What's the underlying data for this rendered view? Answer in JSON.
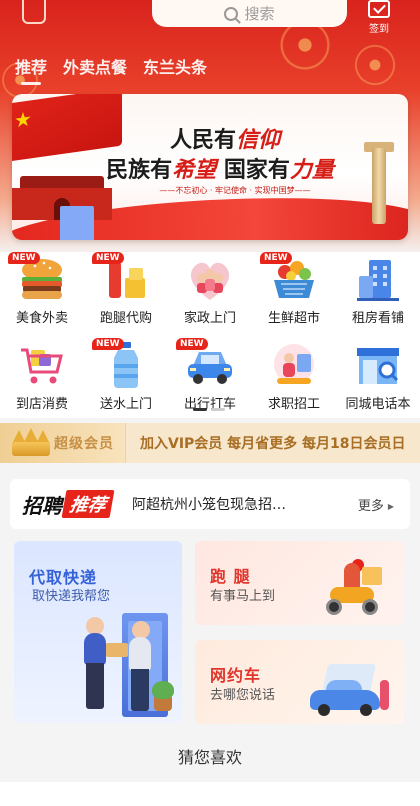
{
  "header": {
    "search_placeholder": "搜索",
    "signin_label": "签到",
    "tabs": [
      {
        "label": "推荐",
        "active": true
      },
      {
        "label": "外卖点餐",
        "active": false
      },
      {
        "label": "东兰头条",
        "active": false
      }
    ],
    "colors": {
      "primary": "#d9231d",
      "accent": "#e6241a"
    }
  },
  "banner": {
    "line1_a": "人民有",
    "line1_b": "信仰",
    "line2_a": "民族有",
    "line2_b": "希望",
    "line2_c": " 国家有",
    "line2_d": "力量",
    "line3": "——不忘初心 · 牢记使命 · 实现中国梦——"
  },
  "services": {
    "new_badge": "NEW",
    "items": [
      {
        "label": "美食外卖",
        "icon": "burger-icon",
        "new": true
      },
      {
        "label": "跑腿代购",
        "icon": "errand-icon",
        "new": true
      },
      {
        "label": "家政上门",
        "icon": "housekeeping-icon",
        "new": false
      },
      {
        "label": "生鲜超市",
        "icon": "fruit-basket-icon",
        "new": true
      },
      {
        "label": "租房看铺",
        "icon": "building-icon",
        "new": false
      },
      {
        "label": "到店消费",
        "icon": "shopping-cart-icon",
        "new": false
      },
      {
        "label": "送水上门",
        "icon": "water-bottle-icon",
        "new": true
      },
      {
        "label": "出行打车",
        "icon": "car-icon",
        "new": true
      },
      {
        "label": "求职招工",
        "icon": "job-icon",
        "new": false
      },
      {
        "label": "同城电话本",
        "icon": "phonebook-icon",
        "new": false
      }
    ]
  },
  "vip": {
    "title": "超级会员",
    "text": "加入VIP会员 每月省更多 每月18日会员日"
  },
  "recruit": {
    "logo_a": "招聘",
    "logo_b": "推荐",
    "headline": "阿超杭州小笼包现急招…",
    "more": "更多"
  },
  "cards": {
    "express": {
      "title": "代取快递",
      "subtitle": "取快递我帮您"
    },
    "errand": {
      "title": "跑 腿",
      "subtitle": "有事马上到"
    },
    "taxi": {
      "title": "网约车",
      "subtitle": "去哪您说话"
    }
  },
  "feed": {
    "title": "猜您喜欢"
  }
}
